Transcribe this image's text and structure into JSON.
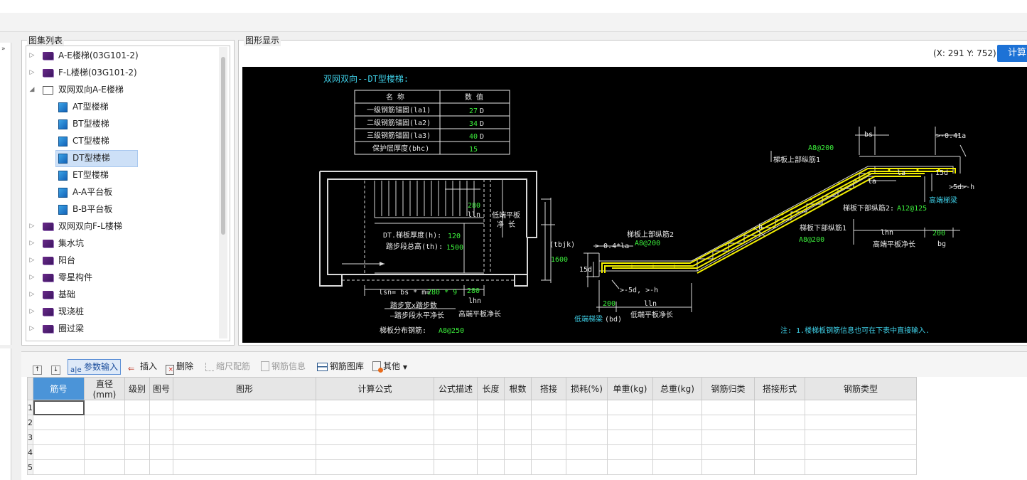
{
  "tree_panel": {
    "title": "图集列表",
    "items": [
      {
        "label": "A-E楼梯(03G101-2)",
        "level": 0,
        "icon": "closed-book-icon",
        "expanded": false
      },
      {
        "label": "F-L楼梯(03G101-2)",
        "level": 0,
        "icon": "closed-book-icon",
        "expanded": false
      },
      {
        "label": "双网双向A-E楼梯",
        "level": 0,
        "icon": "open-book-icon",
        "expanded": true
      },
      {
        "label": "AT型楼梯",
        "level": 1,
        "icon": "document-icon"
      },
      {
        "label": "BT型楼梯",
        "level": 1,
        "icon": "document-icon"
      },
      {
        "label": "CT型楼梯",
        "level": 1,
        "icon": "document-icon"
      },
      {
        "label": "DT型楼梯",
        "level": 1,
        "icon": "document-icon",
        "selected": true
      },
      {
        "label": "ET型楼梯",
        "level": 1,
        "icon": "document-icon"
      },
      {
        "label": "A-A平台板",
        "level": 1,
        "icon": "document-icon"
      },
      {
        "label": "B-B平台板",
        "level": 1,
        "icon": "document-icon"
      },
      {
        "label": "双网双向F-L楼梯",
        "level": 0,
        "icon": "closed-book-icon",
        "expanded": false
      },
      {
        "label": "集水坑",
        "level": 0,
        "icon": "closed-book-icon",
        "expanded": false
      },
      {
        "label": "阳台",
        "level": 0,
        "icon": "closed-book-icon",
        "expanded": false
      },
      {
        "label": "零星构件",
        "level": 0,
        "icon": "closed-book-icon",
        "expanded": false
      },
      {
        "label": "基础",
        "level": 0,
        "icon": "closed-book-icon",
        "expanded": false
      },
      {
        "label": "现浇桩",
        "level": 0,
        "icon": "closed-book-icon",
        "expanded": false
      },
      {
        "label": "圈过梁",
        "level": 0,
        "icon": "closed-book-icon",
        "expanded": false
      }
    ]
  },
  "graphic_panel": {
    "title": "图形显示",
    "coords": "(X: 291 Y: 752)",
    "calc_button": "计算("
  },
  "drawing": {
    "title": "双网双向--DT型楼梯:",
    "param_table": {
      "headers": [
        "名  称",
        "数  值"
      ],
      "rows": [
        {
          "name": "一级钢筋锚固(la1)",
          "value": "27",
          "unit": "D"
        },
        {
          "name": "二级钢筋锚固(la2)",
          "value": "34",
          "unit": "D"
        },
        {
          "name": "三级钢筋锚固(la3)",
          "value": "40",
          "unit": "D"
        },
        {
          "name": "保护层厚度(bhc)",
          "value": "15",
          "unit": ""
        }
      ]
    },
    "plan": {
      "thickness_label": "DT.梯板厚度(h):",
      "thickness_value": "120",
      "height_label": "踏步段总高(th):",
      "height_value": "1500",
      "step_width": "280",
      "lln": "lln",
      "low_platform": "低端平板",
      "net_length": "净  长",
      "tbjk": "(tbjk)",
      "width_1600": "1600",
      "formula_prefix": "lsn= bs * m=",
      "formula_value": "280 * 9",
      "step_280": "280",
      "lhn": "lhn",
      "step_desc": "踏步宽x踏步数",
      "flight_desc": "—踏步段水平净长",
      "high_platform": "高端平板净长",
      "dist_label": "梯板分布钢筋:",
      "dist_value": "A8@250"
    },
    "section": {
      "a8_200_top": "A8@200",
      "upper_bar1": "梯板上部纵筋1",
      "bs": "bs",
      "dim_041la": ">-0.41a",
      "la_1": "la",
      "la_2": "la",
      "d15_right": "15d",
      "d5_right": ">5d>-h",
      "high_beam": "高端梯梁",
      "lower_bar2": "梯板下部纵筋2:",
      "lower_bar2_value": "A12@125",
      "lower_bar1": "梯板下部纵筋1",
      "a8_200_mid": "A8@200",
      "lhn": "lhn",
      "dim_200_right": "200",
      "bg": "bg",
      "high_platform_net": "高端平板净长",
      "upper_bar2": "梯板上部纵筋2",
      "dim_04la": ">-0.4*la",
      "a8_200_left": "A8@200",
      "h_mark": "h",
      "d15_left": "15d",
      "d5_left": ">-5d, >-h",
      "dim_200_left": "200",
      "lln": "lln",
      "low_beam": "低端梯梁",
      "bd": "(bd)",
      "low_platform_net": "低端平板净长"
    },
    "note": "注: 1.楼梯板钢筋信息也可在下表中直接输入."
  },
  "toolbar": {
    "buttons": [
      {
        "label": "",
        "icon": "move-up-icon",
        "enabled": true
      },
      {
        "label": "",
        "icon": "move-down-icon",
        "enabled": true
      },
      {
        "label": "参数输入",
        "icon": "param-input-icon",
        "enabled": true,
        "active": true
      },
      {
        "label": "插入",
        "icon": "insert-icon",
        "enabled": true
      },
      {
        "label": "删除",
        "icon": "delete-icon",
        "enabled": true
      },
      {
        "label": "缩尺配筋",
        "icon": "scale-rebar-icon",
        "enabled": false
      },
      {
        "label": "钢筋信息",
        "icon": "rebar-info-icon",
        "enabled": false
      },
      {
        "label": "钢筋图库",
        "icon": "rebar-library-icon",
        "enabled": true
      },
      {
        "label": "其他",
        "icon": "other-icon",
        "enabled": true,
        "dropdown": true
      }
    ]
  },
  "grid": {
    "columns": [
      "筋号",
      "直径(mm)",
      "级别",
      "图号",
      "图形",
      "计算公式",
      "公式描述",
      "长度",
      "根数",
      "搭接",
      "损耗(%)",
      "单重(kg)",
      "总重(kg)",
      "钢筋归类",
      "搭接形式",
      "钢筋类型"
    ],
    "row_numbers": [
      "1",
      "2",
      "3",
      "4",
      "5"
    ]
  },
  "colors": {
    "accent": "#1d72d6",
    "cad_background": "#000000",
    "cad_cyan": "#3fd0e8",
    "cad_green": "#3cf03c",
    "cad_yellow": "#f4f000"
  }
}
